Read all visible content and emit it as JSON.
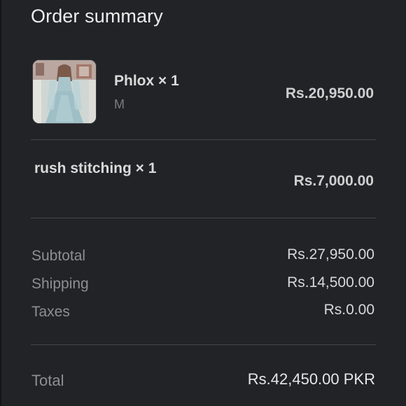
{
  "header": {
    "title": "Order summary"
  },
  "line_items": [
    {
      "name": "Phlox × 1",
      "variant": "M",
      "price": "Rs.20,950.00",
      "image": "dress-product-thumbnail"
    },
    {
      "name": "rush stitching × 1",
      "price": "Rs.7,000.00"
    }
  ],
  "costs": {
    "subtotal_label": "Subtotal",
    "subtotal_value": "Rs.27,950.00",
    "shipping_label": "Shipping",
    "shipping_value": "Rs.14,500.00",
    "taxes_label": "Taxes",
    "taxes_value": "Rs.0.00"
  },
  "total": {
    "label": "Total",
    "value": "Rs.42,450.00 PKR"
  },
  "colors": {
    "background": "#222327",
    "text_primary": "#ECECEC",
    "text_secondary": "#8E8F94",
    "divider": "#45474D"
  }
}
